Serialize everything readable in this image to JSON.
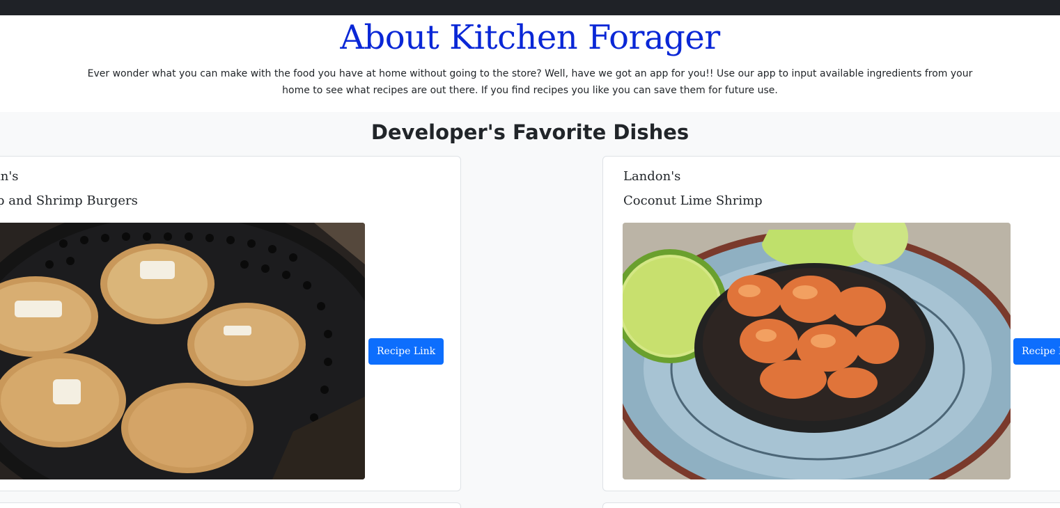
{
  "about": {
    "title": "About Kitchen Forager",
    "description": "Ever wonder what you can make with the food you have at home without going to the store? Well, have we got an app for you!! Use our app to input available ingredients from your home to see what recipes are out there. If you find recipes you like you can save them for future use."
  },
  "favorites": {
    "heading": "Developer's Favorite Dishes",
    "cards": [
      {
        "owner": "in's",
        "dish": "p and Shrimp Burgers",
        "button": "Recipe Link"
      },
      {
        "owner": "Landon's",
        "dish": "Coconut Lime Shrimp",
        "button": "Recipe L"
      }
    ]
  },
  "colors": {
    "topbar": "#1f2227",
    "title_blue": "#0a27d6",
    "button_blue": "#0d6efd",
    "page_bg": "#f8f9fa"
  }
}
